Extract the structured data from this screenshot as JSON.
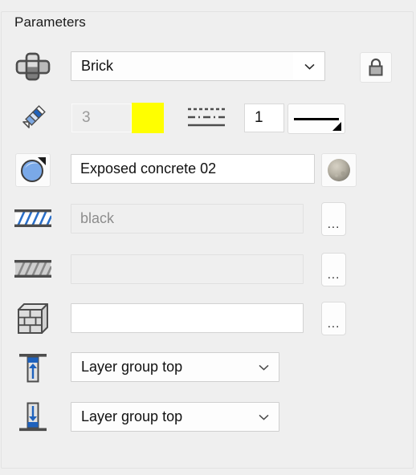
{
  "panel": {
    "group_title": "Parameters",
    "background_color": "#efefef",
    "border_color": "#e2e2e2"
  },
  "rows": [
    {
      "id": "layer-type",
      "icon": "wall-layers-icon",
      "combo_value": "Brick",
      "lock_button": "lock-closed-icon"
    },
    {
      "id": "pen-attributes",
      "icon": "pencil-icon",
      "pen_width": "3",
      "pen_color": "#ffff00",
      "linetype_icon": "line-style-icon",
      "line_number": "1",
      "line_weight_preview": "solid-thick-line"
    },
    {
      "id": "material",
      "icon": "material-sphere-icon",
      "material_name": "Exposed concrete 02",
      "preview": "concrete-sphere-preview"
    },
    {
      "id": "fill-cut",
      "icon": "hatch-blue-icon",
      "value": "black",
      "browse_label": "...",
      "state": "muted"
    },
    {
      "id": "fill-surface",
      "icon": "hatch-grey-icon",
      "value": "",
      "browse_label": "...",
      "state": "muted"
    },
    {
      "id": "brick-pattern",
      "icon": "brick-wall-icon",
      "value": "",
      "browse_label": "...",
      "state": "white"
    },
    {
      "id": "top-connection",
      "icon": "arrow-up-to-bar-icon",
      "combo_value": "Layer group top"
    },
    {
      "id": "bottom-connection",
      "icon": "arrow-down-to-bar-icon",
      "combo_value": "Layer group top"
    }
  ],
  "colors": {
    "accent_blue": "#2a6fc9",
    "icon_grey": "#4d4d4d",
    "yellow_swatch": "#ffff00",
    "field_border": "#d2d2d2"
  }
}
